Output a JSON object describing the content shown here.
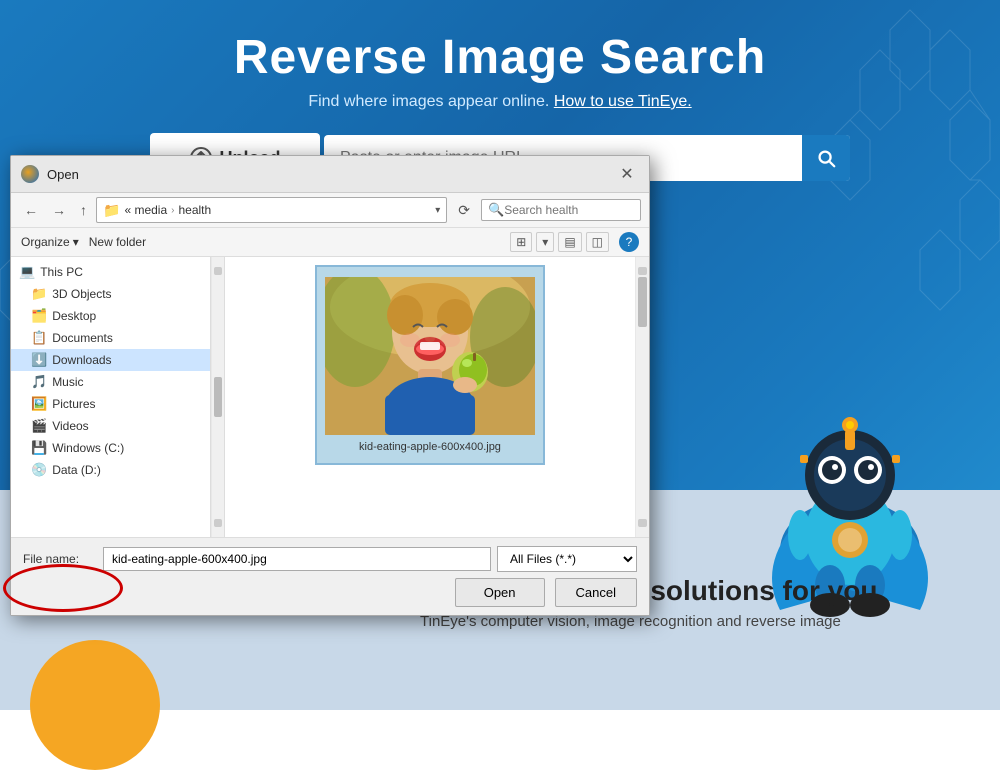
{
  "page": {
    "title": "Reverse Image Search",
    "subtitle": "Find where images appear online.",
    "subtitle_link": "How to use TinEye.",
    "upload_btn": "Upload",
    "url_placeholder": "Paste or enter image URL",
    "bottom_heading": "Search by image solutions for you",
    "bottom_subtext": "TinEye's computer vision, image recognition and reverse image"
  },
  "dialog": {
    "title": "Open",
    "close_btn": "✕",
    "breadcrumb": {
      "prefix": "« media",
      "arrow": "›",
      "current": "health"
    },
    "search_placeholder": "Search health",
    "organize_label": "Organize",
    "new_folder_label": "New folder",
    "tree_items": [
      {
        "id": "this-pc",
        "label": "This PC",
        "icon": "💻",
        "indent": 0
      },
      {
        "id": "3d-objects",
        "label": "3D Objects",
        "icon": "📦",
        "indent": 1
      },
      {
        "id": "desktop",
        "label": "Desktop",
        "icon": "🗂️",
        "indent": 1
      },
      {
        "id": "documents",
        "label": "Documents",
        "icon": "📋",
        "indent": 1
      },
      {
        "id": "downloads",
        "label": "Downloads",
        "icon": "⬇️",
        "indent": 1
      },
      {
        "id": "music",
        "label": "Music",
        "icon": "♪",
        "indent": 1
      },
      {
        "id": "pictures",
        "label": "Pictures",
        "icon": "🖼️",
        "indent": 1
      },
      {
        "id": "videos",
        "label": "Videos",
        "icon": "🎬",
        "indent": 1
      },
      {
        "id": "windows-c",
        "label": "Windows (C:)",
        "icon": "💾",
        "indent": 1
      },
      {
        "id": "data-d",
        "label": "Data (D:)",
        "icon": "💾",
        "indent": 1
      }
    ],
    "file_name_label": "File name:",
    "file_name_value": "kid-eating-apple-600x400.jpg",
    "file_type_label": "All Files (*.*)",
    "selected_file": "kid-eating-apple-600x400.jpg",
    "open_btn": "Open",
    "cancel_btn": "Cancel"
  }
}
